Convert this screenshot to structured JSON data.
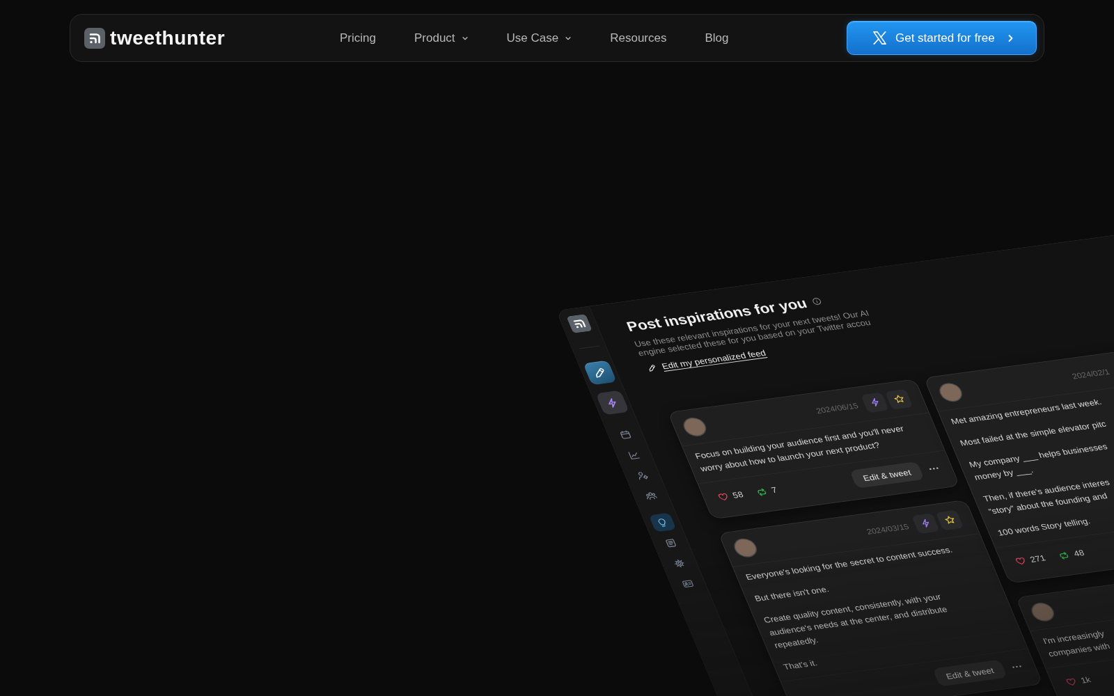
{
  "nav": {
    "brand": "tweethunter",
    "links": [
      {
        "label": "Pricing",
        "dropdown": false
      },
      {
        "label": "Product",
        "dropdown": true
      },
      {
        "label": "Use Case",
        "dropdown": true
      },
      {
        "label": "Resources",
        "dropdown": false
      },
      {
        "label": "Blog",
        "dropdown": false
      }
    ],
    "cta": "Get started for free"
  },
  "app": {
    "sidebar": {
      "actions": [
        {
          "kind": "primary"
        },
        {
          "kind": "secondary"
        }
      ],
      "groups": [
        [
          {
            "selected": false
          },
          {
            "selected": false
          },
          {
            "selected": false
          },
          {
            "selected": false
          }
        ],
        [
          {
            "selected": true
          },
          {
            "selected": false
          },
          {
            "selected": false
          },
          {
            "selected": false
          }
        ]
      ]
    },
    "title": "Post inspirations for you",
    "subtitle": "Use these relevant inspirations for your next tweets! Our AI engine selected these for you based on your Twitter accou",
    "edit_link": "Edit my personalized feed",
    "columns": [
      [
        {
          "date": "2024/06/15",
          "quick_actions": true,
          "paragraphs": [
            "Focus on building your audience first and you'll never\nworry about how to launch your next product?"
          ],
          "likes": "58",
          "retweets": "7",
          "edit_button": "Edit & tweet"
        },
        {
          "date": "2024/03/15",
          "quick_actions": true,
          "paragraphs": [
            "Everyone's looking for the secret to content success.",
            "But there isn't one.",
            "Create quality content, consistently, with your\naudience's needs at the center, and distribute\nrepeatedly.",
            "That's it."
          ],
          "edit_button": "Edit & tweet"
        }
      ],
      [
        {
          "date": "2024/02/1",
          "paragraphs": [
            "Met amazing entrepreneurs last week.",
            "Most failed at the simple elevator pitc",
            "My company ___ helps businesses\nmoney by ___.",
            "Then, if there's audience interes\n“story” about the founding and",
            "100 words Story telling."
          ],
          "likes": "271",
          "retweets": "48"
        },
        {
          "paragraphs": [
            "I'm increasingly\ncompanies with"
          ],
          "likes": "1k"
        }
      ]
    ]
  }
}
